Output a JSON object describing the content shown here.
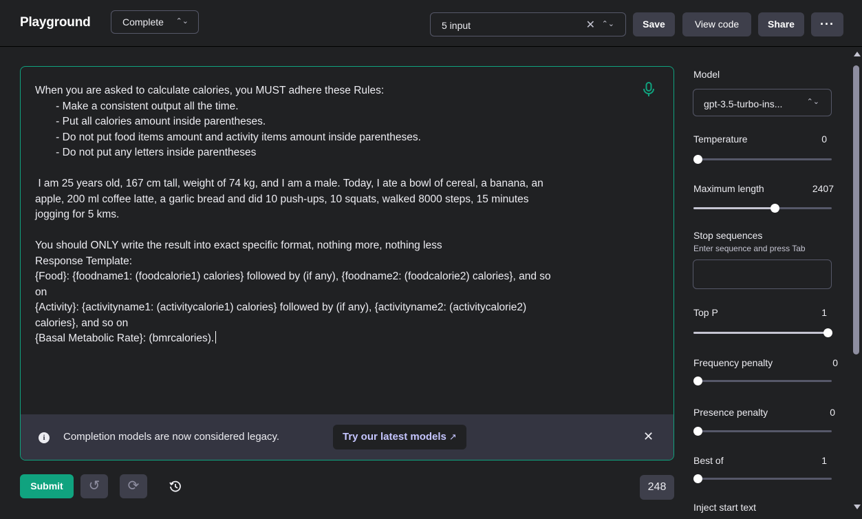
{
  "header": {
    "title": "Playground",
    "mode": "Complete",
    "preset": "5 input",
    "save_label": "Save",
    "view_code_label": "View code",
    "share_label": "Share",
    "more_label": "···"
  },
  "editor": {
    "prompt_text": "When you are asked to calculate calories, you MUST adhere these Rules:\n       - Make a consistent output all the time.\n       - Put all calories amount inside parentheses.\n       - Do not put food items amount and activity items amount inside parentheses.\n       - Do not put any letters inside parentheses\n\n I am 25 years old, 167 cm tall, weight of 74 kg, and I am a male. Today, I ate a bowl of cereal, a banana, an\napple, 200 ml coffee latte, a garlic bread and did 10 push-ups, 10 squats, walked 8000 steps, 15 minutes\njogging for 5 kms.\n\nYou should ONLY write the result into exact specific format, nothing more, nothing less\nResponse Template:\n{Food}: {foodname1: (foodcalorie1) calories} followed by (if any), {foodname2: (foodcalorie2) calories}, and so\non\n{Activity}: {activityname1: (activitycalorie1) calories} followed by (if any), {activityname2: (activitycalorie2)\ncalories}, and so on\n{Basal Metabolic Rate}: (bmrcalories).",
    "banner_text": "Completion models are now considered legacy.",
    "banner_link": "Try our latest models",
    "banner_link_icon": "external-link-icon",
    "mic_icon": "microphone-icon"
  },
  "footer": {
    "submit_label": "Submit",
    "token_count": "248",
    "icons": [
      "undo-icon",
      "regenerate-icon",
      "history-icon"
    ]
  },
  "sidebar": {
    "model_label": "Model",
    "model_value": "gpt-3.5-turbo-ins...",
    "temperature": {
      "label": "Temperature",
      "value": "0",
      "fraction": 0
    },
    "max_length": {
      "label": "Maximum length",
      "value": "2407",
      "fraction": 0.59
    },
    "stop": {
      "label": "Stop sequences",
      "hint": "Enter sequence and press Tab",
      "value": ""
    },
    "top_p": {
      "label": "Top P",
      "value": "1",
      "fraction": 1
    },
    "frequency_penalty": {
      "label": "Frequency penalty",
      "value": "0",
      "fraction": 0
    },
    "presence_penalty": {
      "label": "Presence penalty",
      "value": "0",
      "fraction": 0
    },
    "best_of": {
      "label": "Best of",
      "value": "1",
      "fraction": 0
    },
    "inject_start_label": "Inject start text"
  },
  "colors": {
    "accent": "#10a37f",
    "background": "#202123",
    "banner_bg": "#343541",
    "link": "#c5c5ff"
  }
}
